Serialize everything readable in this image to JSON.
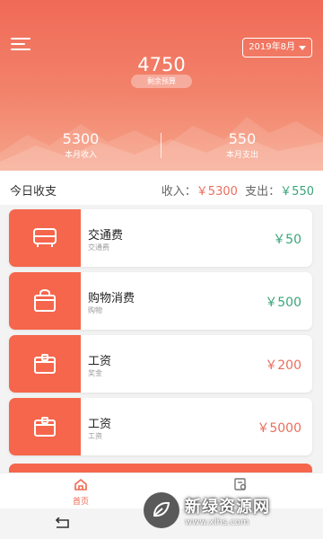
{
  "header": {
    "date_select": "2019年8月",
    "balance": "4750",
    "balance_label": "剩余预算",
    "income": {
      "value": "5300",
      "label": "本月收入"
    },
    "expense": {
      "value": "550",
      "label": "本月支出"
    }
  },
  "summary": {
    "title": "今日收支",
    "income_label": "收入：",
    "income_value": "￥5300",
    "expense_label": "支出：",
    "expense_value": "￥550"
  },
  "records": [
    {
      "icon": "bus-icon",
      "name": "交通费",
      "category": "交通费",
      "amount": "￥50",
      "type": "expense"
    },
    {
      "icon": "shopping-bag-icon",
      "name": "购物消费",
      "category": "购物",
      "amount": "￥500",
      "type": "expense"
    },
    {
      "icon": "wallet-icon",
      "name": "工资",
      "category": "奖金",
      "amount": "￥200",
      "type": "income"
    },
    {
      "icon": "wallet-icon",
      "name": "工资",
      "category": "工资",
      "amount": "￥5000",
      "type": "income"
    }
  ],
  "tabbar": {
    "home_label": "首页",
    "stats_label": ""
  },
  "watermark": {
    "title": "新绿资源网",
    "url": "www.xlhs.com"
  },
  "colors": {
    "accent": "#f5664c",
    "income": "#e86f5f",
    "expense": "#3aa57a"
  }
}
